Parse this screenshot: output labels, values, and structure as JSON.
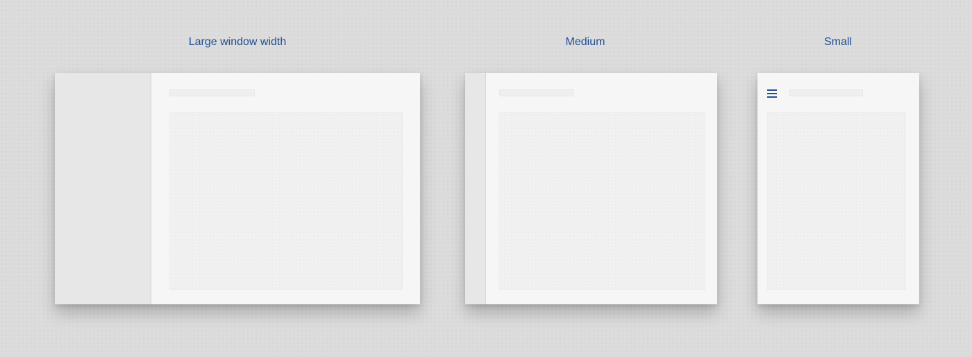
{
  "layouts": [
    {
      "label": "Large window width"
    },
    {
      "label": "Medium"
    },
    {
      "label": "Small"
    }
  ],
  "colors": {
    "accent": "#1f4e93",
    "background": "#dcdcdc",
    "window": "#f6f6f6",
    "pane": "#e7e7e7"
  },
  "icons": {
    "menu": "hamburger-menu-icon"
  }
}
